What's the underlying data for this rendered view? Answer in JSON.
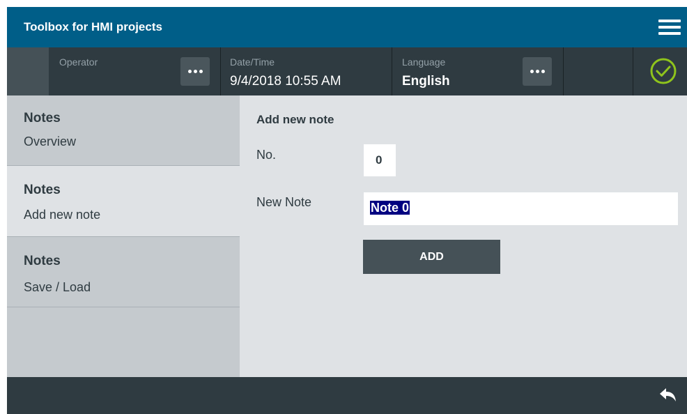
{
  "app": {
    "title": "Toolbox for HMI projects"
  },
  "status_bar": {
    "operator_label": "Operator",
    "operator_value": "",
    "datetime_label": "Date/Time",
    "datetime_value": "9/4/2018 10:55 AM",
    "language_label": "Language",
    "language_value": "English",
    "status_icon": "check-circle-icon"
  },
  "sidebar": {
    "items": [
      {
        "title": "Notes",
        "subtitle": "Overview",
        "active": false
      },
      {
        "title": "Notes",
        "subtitle": "Add new note",
        "active": true
      },
      {
        "title": "Notes",
        "subtitle": "Save / Load",
        "active": false
      }
    ]
  },
  "main": {
    "section_title": "Add new note",
    "no_label": "No.",
    "no_value": "0",
    "note_label": "New Note",
    "note_value": "Note 0",
    "add_button": "ADD"
  },
  "colors": {
    "title_bar": "#005e88",
    "status_bar": "#2f3b41",
    "sidebar": "#c5cace",
    "content": "#dfe2e5",
    "ok_green": "#8fc41c"
  }
}
